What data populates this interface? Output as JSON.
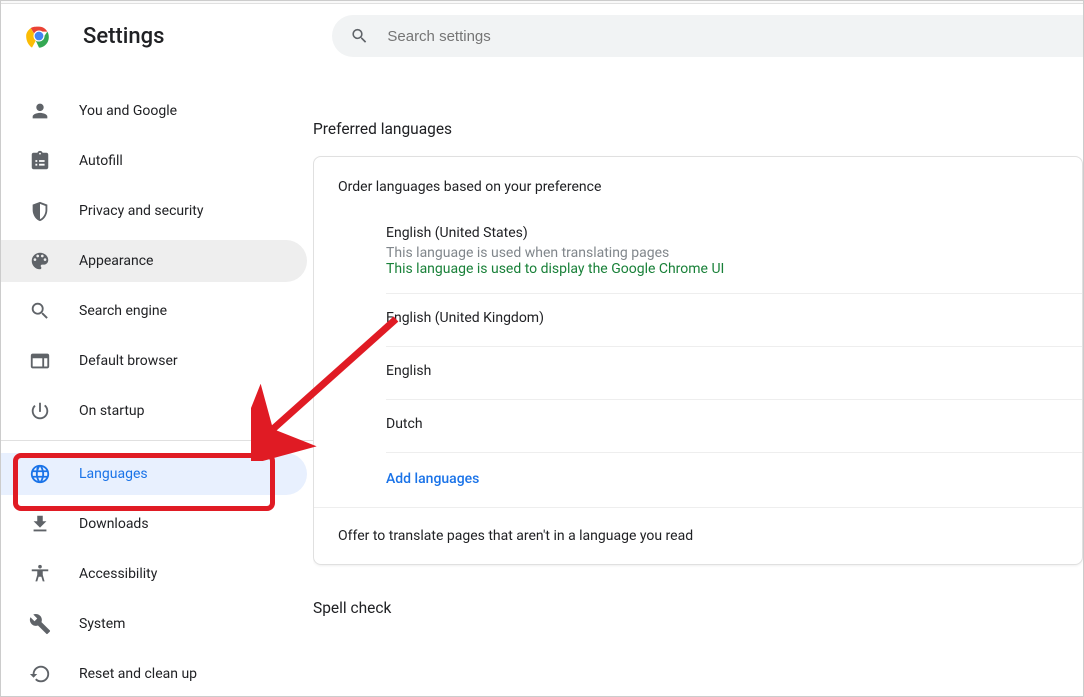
{
  "header": {
    "title": "Settings",
    "search_placeholder": "Search settings"
  },
  "sidebar": {
    "items": [
      {
        "id": "you-and-google",
        "label": "You and Google"
      },
      {
        "id": "autofill",
        "label": "Autofill"
      },
      {
        "id": "privacy",
        "label": "Privacy and security"
      },
      {
        "id": "appearance",
        "label": "Appearance"
      },
      {
        "id": "search-engine",
        "label": "Search engine"
      },
      {
        "id": "default-browser",
        "label": "Default browser"
      },
      {
        "id": "on-startup",
        "label": "On startup"
      },
      {
        "id": "languages",
        "label": "Languages"
      },
      {
        "id": "downloads",
        "label": "Downloads"
      },
      {
        "id": "accessibility",
        "label": "Accessibility"
      },
      {
        "id": "system",
        "label": "System"
      },
      {
        "id": "reset",
        "label": "Reset and clean up"
      }
    ]
  },
  "main": {
    "preferred_title": "Preferred languages",
    "order_text": "Order languages based on your preference",
    "languages": [
      {
        "name": "English (United States)",
        "sub1": "This language is used when translating pages",
        "sub2": "This language is used to display the Google Chrome UI"
      },
      {
        "name": "English (United Kingdom)"
      },
      {
        "name": "English"
      },
      {
        "name": "Dutch"
      }
    ],
    "add_languages": "Add languages",
    "translate_offer": "Offer to translate pages that aren't in a language you read",
    "spell_check_title": "Spell check"
  }
}
